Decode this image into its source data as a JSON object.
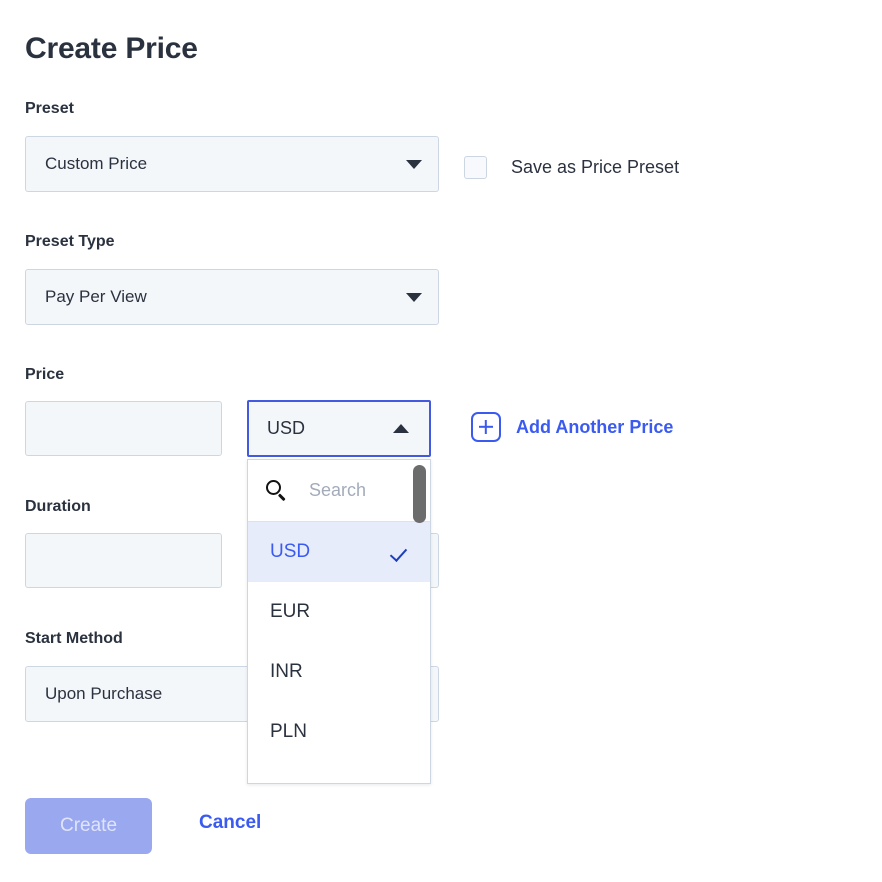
{
  "dialog": {
    "title": "Create Price"
  },
  "preset": {
    "label": "Preset",
    "value": "Custom Price",
    "caret_icon": "chevron-down-icon"
  },
  "save_preset": {
    "label": "Save as Price Preset",
    "checked": false
  },
  "preset_type": {
    "label": "Preset Type",
    "value": "Pay Per View",
    "caret_icon": "chevron-down-icon"
  },
  "price": {
    "label": "Price",
    "amount_value": "",
    "amount_placeholder": "",
    "currency": {
      "value": "USD",
      "caret_icon": "chevron-up-icon",
      "expanded": true,
      "search": {
        "placeholder": "Search",
        "value": "",
        "icon": "search-icon"
      },
      "options": [
        {
          "label": "USD",
          "selected": true
        },
        {
          "label": "EUR",
          "selected": false
        },
        {
          "label": "INR",
          "selected": false
        },
        {
          "label": "PLN",
          "selected": false
        }
      ]
    }
  },
  "add_another_price": {
    "label": "Add Another Price",
    "icon": "plus-square-icon"
  },
  "duration": {
    "label": "Duration",
    "value": "",
    "unit_value": ""
  },
  "start_method": {
    "label": "Start Method",
    "value": "Upon Purchase",
    "caret_icon": "chevron-down-icon"
  },
  "footer": {
    "create_label": "Create",
    "cancel_label": "Cancel"
  },
  "colors": {
    "accent": "#3b5bf0",
    "focus_border": "#4259e0",
    "field_bg": "#f4f7fa",
    "field_border": "#cdd7e3",
    "selected_option_bg": "#e7ecfb",
    "disabled_button_bg": "#9aa8ef",
    "text": "#2b323f"
  }
}
